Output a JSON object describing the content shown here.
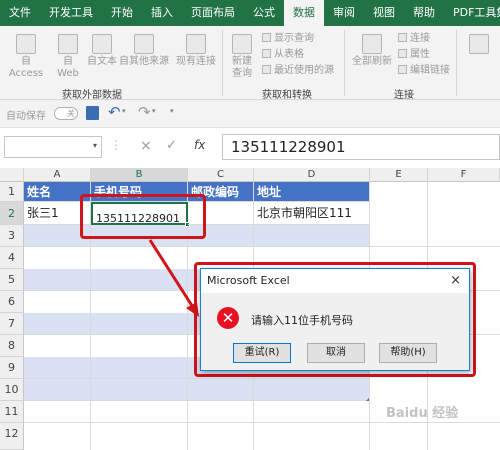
{
  "tabs": [
    "文件",
    "开发工具",
    "开始",
    "插入",
    "页面布局",
    "公式",
    "数据",
    "审阅",
    "视图",
    "帮助",
    "PDF工具集"
  ],
  "active_tab": "数据",
  "ribbon": {
    "access": "自 Access",
    "web_1": "自",
    "web_2": "Web",
    "text": "自文本",
    "other_sources": "自其他来源",
    "existing": "现有连接",
    "new_query_1": "新建",
    "new_query_2": "查询",
    "show_queries": "显示查询",
    "from_table": "从表格",
    "recent_sources": "最近使用的源",
    "refresh_all": "全部刷新",
    "connections": "连接",
    "properties": "属性",
    "edit_links": "编辑链接",
    "group_external": "获取外部数据",
    "group_transform": "获取和转换",
    "group_connections": "连接"
  },
  "qat": {
    "autosave": "自动保存",
    "toggle": "关"
  },
  "formula_bar": {
    "cancel": "×",
    "enter": "✓",
    "fx": "fx",
    "value": "135111228901"
  },
  "columns": [
    "A",
    "B",
    "C",
    "D",
    "E",
    "F"
  ],
  "rows": [
    "1",
    "2",
    "3",
    "4",
    "5",
    "6",
    "7",
    "8",
    "9",
    "10",
    "11",
    "12"
  ],
  "header_row": [
    "姓名",
    "手机号码",
    "邮政编码",
    "地址"
  ],
  "data_row": [
    "张三1",
    "135111228901",
    "",
    "北京市朝阳区111"
  ],
  "dialog": {
    "title": "Microsoft Excel",
    "close": "×",
    "message": "请输入11位手机号码",
    "retry": "重试(R)",
    "cancel": "取消",
    "help": "帮助(H)"
  },
  "colors": {
    "ribbon_green": "#217346",
    "table_header": "#4472c4",
    "band": "#d9e1f2",
    "highlight": "#d0141a",
    "error": "#e81123"
  },
  "watermark": "Baidu 经验"
}
